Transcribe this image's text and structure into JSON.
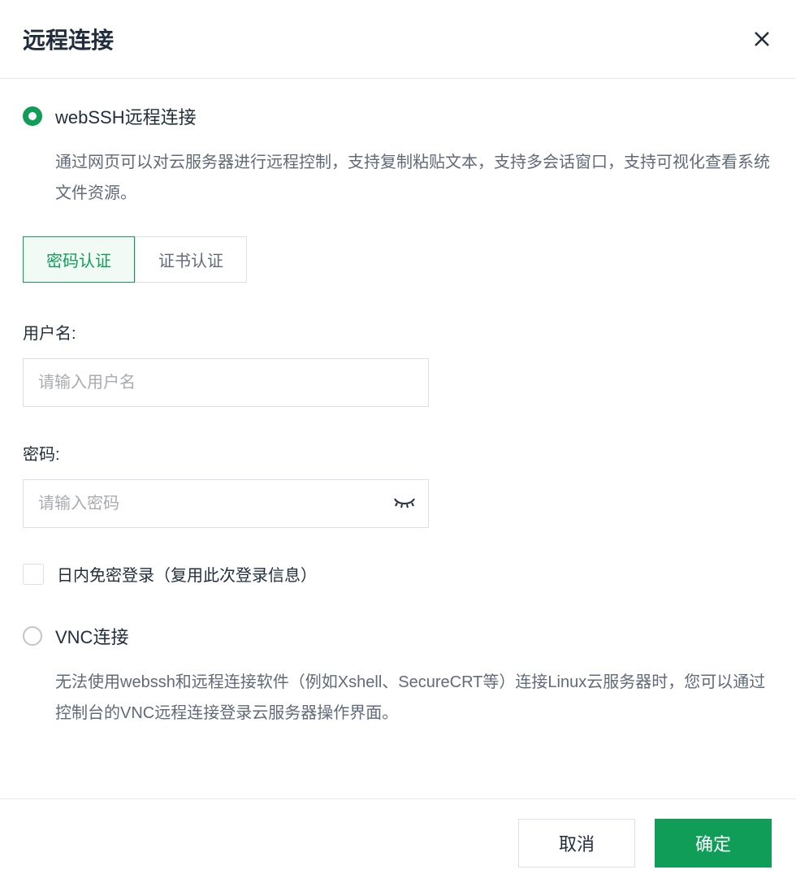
{
  "dialog": {
    "title": "远程连接"
  },
  "options": {
    "webssh": {
      "label": "webSSH远程连接",
      "desc": "通过网页可以对云服务器进行远程控制，支持复制粘贴文本，支持多会话窗口，支持可视化查看系统文件资源。"
    },
    "vnc": {
      "label": "VNC连接",
      "desc": "无法使用webssh和远程连接软件（例如Xshell、SecureCRT等）连接Linux云服务器时，您可以通过控制台的VNC远程连接登录云服务器操作界面。"
    }
  },
  "tabs": {
    "password": "密码认证",
    "cert": "证书认证"
  },
  "form": {
    "username_label": "用户名:",
    "username_placeholder": "请输入用户名",
    "password_label": "密码:",
    "password_placeholder": "请输入密码",
    "remember_label": "日内免密登录（复用此次登录信息）"
  },
  "footer": {
    "cancel": "取消",
    "confirm": "确定"
  }
}
